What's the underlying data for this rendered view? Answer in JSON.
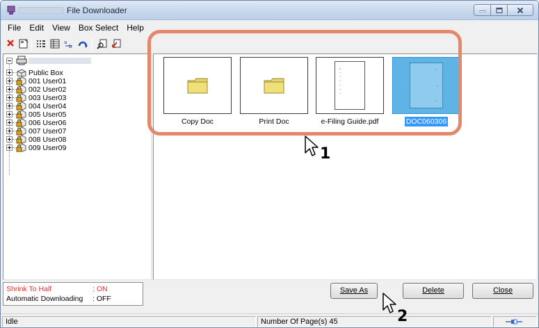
{
  "window": {
    "title": "File Downloader"
  },
  "menu": [
    "File",
    "Edit",
    "View",
    "Box Select",
    "Help"
  ],
  "tree": {
    "items": [
      "Public Box",
      "001 User01",
      "002 User02",
      "003 User03",
      "004 User04",
      "005 User05",
      "006 User06",
      "007 User07",
      "008 User08",
      "009 User09"
    ]
  },
  "files": [
    {
      "name": "Copy Doc",
      "kind": "folder"
    },
    {
      "name": "Print Doc",
      "kind": "folder"
    },
    {
      "name": "e-Filing Guide.pdf",
      "kind": "document"
    },
    {
      "name": "DOC060306",
      "kind": "image",
      "selected": true
    }
  ],
  "settings": {
    "shrink_label": "Shrink To Half",
    "shrink_value": ": ON",
    "auto_label": "Automatic Downloading",
    "auto_value": ": OFF"
  },
  "buttons": {
    "save_as": "Save As",
    "delete": "Delete",
    "close": "Close"
  },
  "status": {
    "state": "Idle",
    "pages": "Number Of Page(s) 45"
  },
  "steps": {
    "one": "1",
    "two": "2"
  },
  "colors": {
    "highlight": "#e5876b",
    "selection": "#3399ff",
    "shrink_text": "#e53030"
  }
}
